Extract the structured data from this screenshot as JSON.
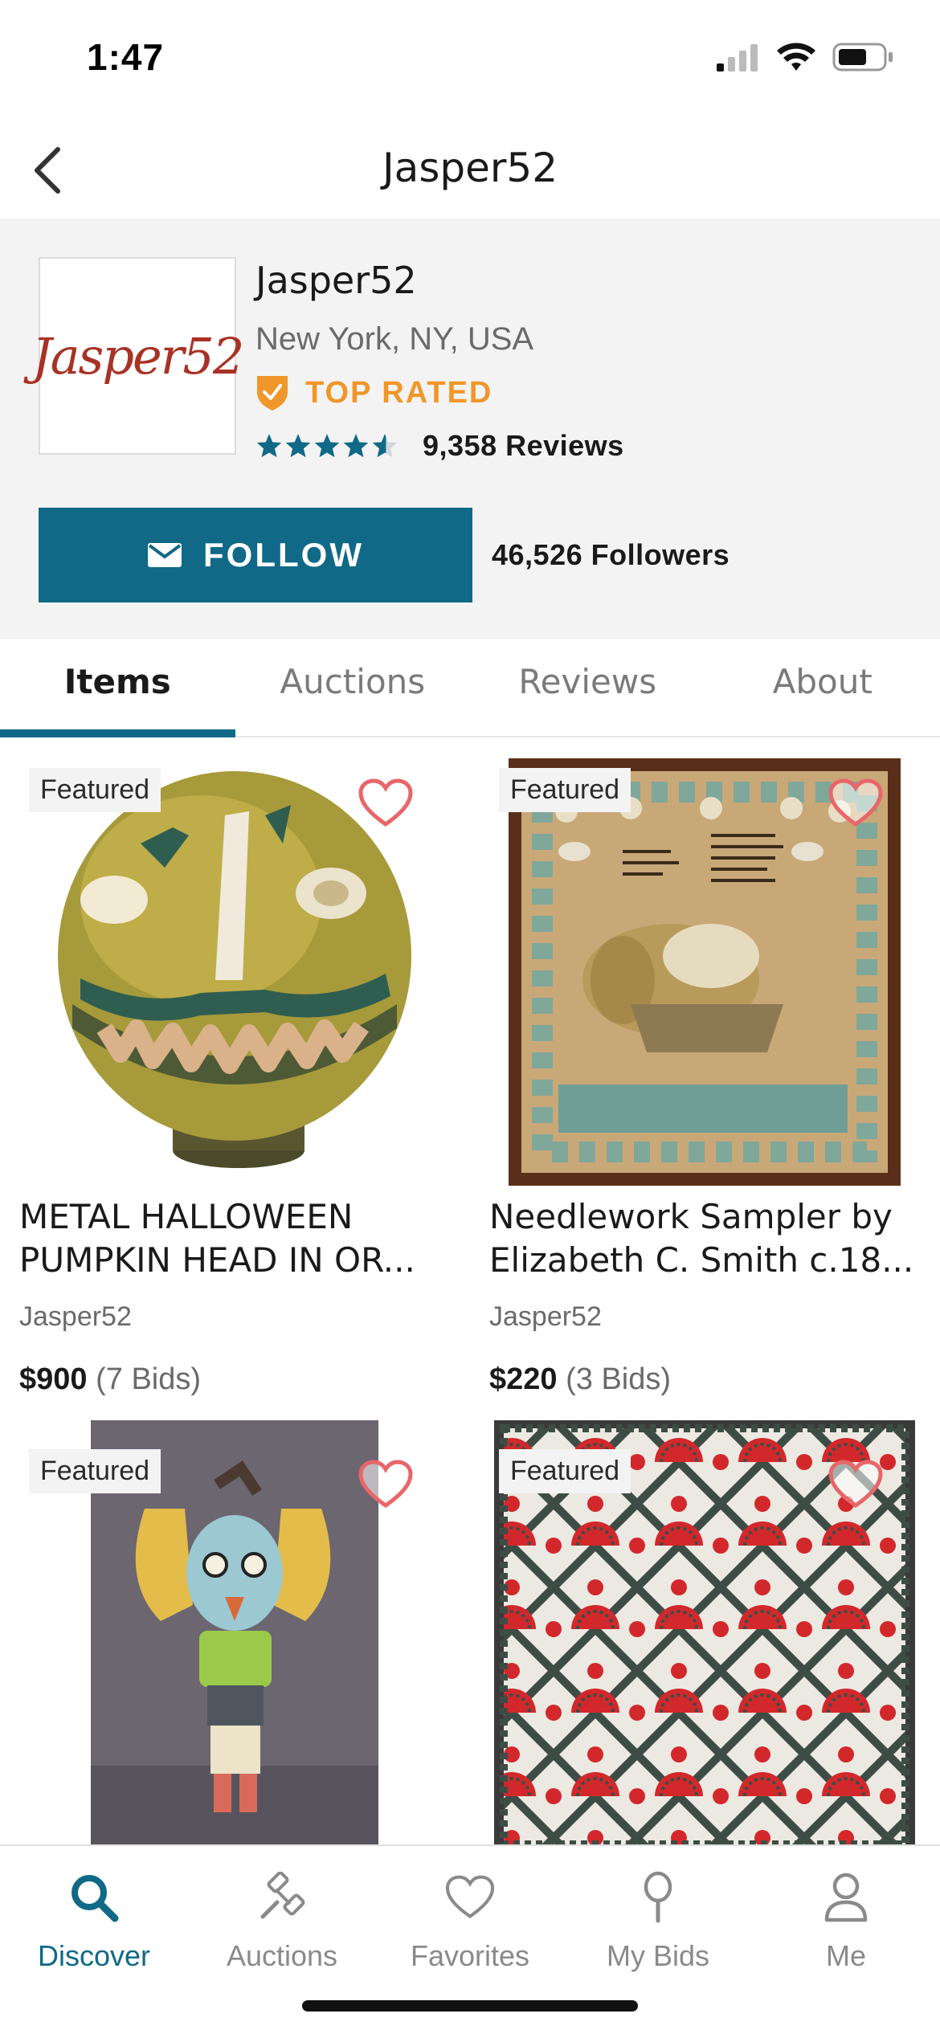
{
  "status_bar": {
    "time": "1:47"
  },
  "nav": {
    "title": "Jasper52"
  },
  "seller": {
    "logo_text": "Jasper52",
    "name": "Jasper52",
    "location": "New York, NY, USA",
    "badge": "TOP RATED",
    "rating_stars": 4.5,
    "reviews": "9,358 Reviews",
    "follow_label": "FOLLOW",
    "followers": "46,526 Followers"
  },
  "tabs": [
    {
      "label": "Items",
      "active": true
    },
    {
      "label": "Auctions",
      "active": false
    },
    {
      "label": "Reviews",
      "active": false
    },
    {
      "label": "About",
      "active": false
    }
  ],
  "items": [
    {
      "badge": "Featured",
      "title": "METAL HALLOWEEN PUMPKIN HEAD IN OR...",
      "seller": "Jasper52",
      "price": "$900",
      "bids": "(7 Bids)"
    },
    {
      "badge": "Featured",
      "title": "Needlework Sampler by Elizabeth C. Smith c.18...",
      "seller": "Jasper52",
      "price": "$220",
      "bids": "(3 Bids)"
    },
    {
      "badge": "Featured"
    },
    {
      "badge": "Featured"
    }
  ],
  "bottom_nav": [
    {
      "label": "Discover",
      "icon": "search-icon",
      "active": true
    },
    {
      "label": "Auctions",
      "icon": "gavel-icon",
      "active": false
    },
    {
      "label": "Favorites",
      "icon": "heart-icon",
      "active": false
    },
    {
      "label": "My Bids",
      "icon": "paddle-icon",
      "active": false
    },
    {
      "label": "Me",
      "icon": "person-icon",
      "active": false
    }
  ],
  "colors": {
    "accent": "#106986",
    "top_rated": "#f0962a",
    "favorite": "#e8666a",
    "logo": "#a83225"
  }
}
